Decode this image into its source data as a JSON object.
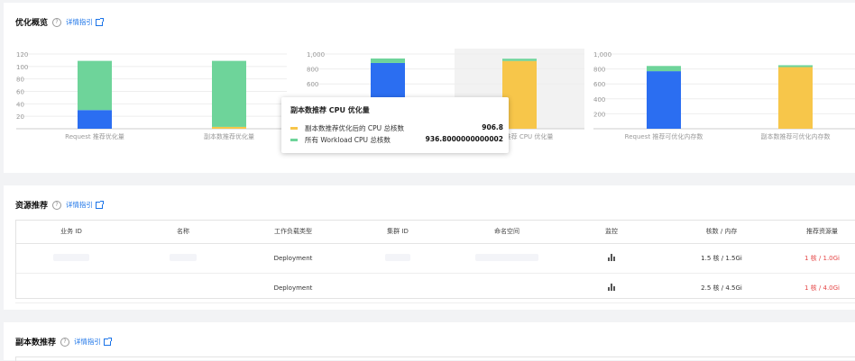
{
  "overview": {
    "title": "优化概览",
    "guide_label": "详情指引"
  },
  "resource": {
    "title": "资源推荐",
    "guide_label": "详情指引",
    "columns": [
      "业务 ID",
      "名称",
      "工作负载类型",
      "集群 ID",
      "命名空间",
      "监控",
      "核数 / 内存",
      "推荐资源量"
    ],
    "rows": [
      {
        "workload_type": "Deployment",
        "cpu_mem": "1.5 核 / 1.5Gi",
        "recommend": "1 核 / 1.0Gi"
      },
      {
        "workload_type": "Deployment",
        "cpu_mem": "2.5 核 / 4.5Gi",
        "recommend": "1 核 / 4.0Gi"
      }
    ]
  },
  "replica": {
    "title": "副本数推荐",
    "guide_label": "详情指引"
  },
  "tooltip": {
    "title": "副本数推荐 CPU 优化量",
    "rows": [
      {
        "label": "副本数推荐优化后的 CPU 总核数",
        "value": "906.8",
        "color": "#f7c64a"
      },
      {
        "label": "所有 Workload CPU 总核数",
        "value": "936.8000000000002",
        "color": "#6ed49a"
      }
    ]
  },
  "colors": {
    "blue": "#2b6ef1",
    "green": "#6ed49a",
    "yellow": "#f7c64a",
    "red": "#e54545",
    "link": "#1a73e8"
  },
  "chart_data": [
    {
      "type": "bar",
      "stacked": true,
      "y_ticks": [
        "20",
        "40",
        "60",
        "80",
        "100",
        "120"
      ],
      "ylim": [
        0,
        120
      ],
      "categories": [
        "Request 推荐优化量",
        "副本数推荐优化量"
      ],
      "series": [
        {
          "color": "#2b6ef1",
          "values": [
            30,
            0
          ]
        },
        {
          "color": "#f7c64a",
          "values": [
            0,
            3
          ]
        },
        {
          "color": "#6ed49a",
          "values": [
            79,
            106
          ]
        }
      ]
    },
    {
      "type": "bar",
      "stacked": true,
      "y_ticks": [
        "600",
        "800",
        "1,000"
      ],
      "ylim": [
        0,
        1000
      ],
      "categories": [
        "",
        "副本数推荐 CPU 优化量"
      ],
      "series": [
        {
          "color": "#2b6ef1",
          "values": [
            880,
            0
          ]
        },
        {
          "color": "#f7c64a",
          "values": [
            0,
            906.8
          ]
        },
        {
          "color": "#6ed49a",
          "values": [
            60,
            30
          ]
        }
      ]
    },
    {
      "type": "bar",
      "stacked": true,
      "y_ticks": [
        "200",
        "400",
        "600",
        "800",
        "1,000"
      ],
      "ylim": [
        0,
        1000
      ],
      "categories": [
        "Request 推荐可优化内存数",
        "副本数推荐可优化内存数"
      ],
      "series": [
        {
          "color": "#2b6ef1",
          "values": [
            770,
            0
          ]
        },
        {
          "color": "#f7c64a",
          "values": [
            0,
            825
          ]
        },
        {
          "color": "#6ed49a",
          "values": [
            70,
            25
          ]
        }
      ]
    }
  ]
}
